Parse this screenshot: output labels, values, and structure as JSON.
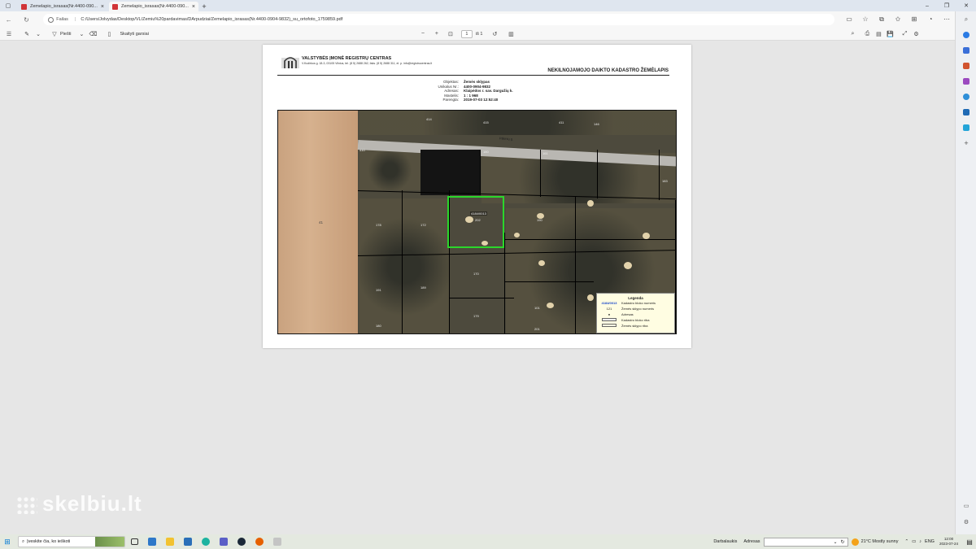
{
  "browser": {
    "tabs": [
      {
        "label": "Zemelapio_israsas(Nr.4400-090...",
        "active": false
      },
      {
        "label": "Zemelapio_israsas(Nr.4400-090...",
        "active": true
      }
    ],
    "url_prefix": "Failas",
    "url": "C:/Users/Jolvydas/Desktop/VL/Zemiu%20pardavimas/DArpudziai/Zemelapio_israsas(Nr.4400-0904-9832)_su_ortofoto_1759859.pdf"
  },
  "pdf_toolbar": {
    "draw_label": "Piešti",
    "read_aloud_label": "Skaityti garsiai",
    "zoom_out": "−",
    "zoom_in": "+",
    "page_current": "1",
    "page_total": "iš 1"
  },
  "document": {
    "org_name": "VALSTYBĖS ĮMONĖ REGISTRŲ CENTRAS",
    "org_address": "V.Kudirkos g. 18-3, 03105 Vilnius, tel. (8 5) 2688 262, faks. (8 5) 2688 311, el. p. info@registrucentras.lt",
    "title": "NEKILNOJAMOJO DAIKTO KADASTRO ŽEMĖLAPIS",
    "meta": [
      {
        "key": "Objektas:",
        "value": "Žemės sklypas"
      },
      {
        "key": "Unikalus Nr.:",
        "value": "4400-0904-9832"
      },
      {
        "key": "Adresas:",
        "value": "Klaipėdos r. sav. Dargužių k."
      },
      {
        "key": "Mastelis:",
        "value": "1 : 1 968"
      },
      {
        "key": "Parengta:",
        "value": "2019-07-03 12:52:40"
      }
    ],
    "map": {
      "road_label": "Pilkinių g.",
      "field_number": "41",
      "lot_number": "4184/0013",
      "lot_sub": "202",
      "plot_labels": [
        "414",
        "415",
        "411",
        "146",
        "410",
        "160",
        "161",
        "183",
        "178",
        "172",
        "190",
        "191",
        "189",
        "170",
        "101",
        "179",
        "180",
        "201"
      ]
    },
    "legend": {
      "title": "Legenda",
      "rows": [
        {
          "sym": "4184/0013",
          "label": "Kadastro bloko numeris"
        },
        {
          "sym": "121",
          "label": "Žemės sklypo numeris"
        },
        {
          "sym": "●",
          "label": "Adresas"
        },
        {
          "sym": "",
          "label": "Kadastro bloko riba"
        },
        {
          "sym": "",
          "label": "Žemės sklypo riba"
        }
      ]
    }
  },
  "watermark": "skelbiu.lt",
  "taskbar": {
    "search_placeholder": "Įveskite čia, ko ieškoti",
    "desktop_label": "Darbalaukis",
    "address_label": "Adresas",
    "weather": "21°C  Mostly sunny",
    "lang": "ENG",
    "time": "12:00",
    "date": "2023-07-24"
  }
}
